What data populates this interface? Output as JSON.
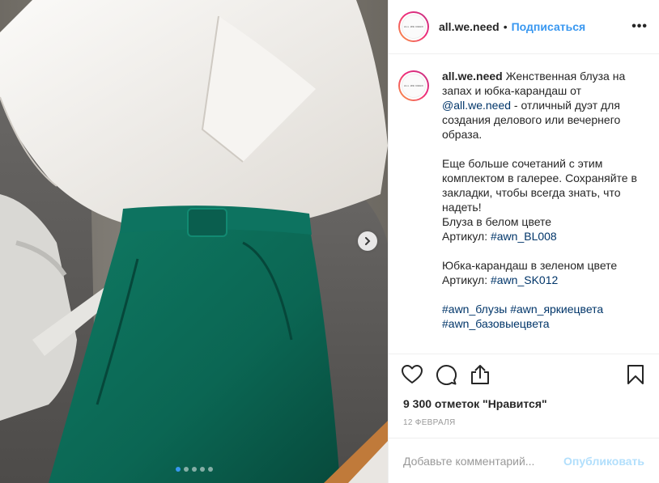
{
  "header": {
    "username": "all.we.need",
    "separator": "•",
    "follow_label": "Подписаться",
    "more_label": "•••"
  },
  "avatar": {
    "logo_text": "ALL WE NEED"
  },
  "caption": {
    "username": "all.we.need",
    "line1": " Женственная блуза на запах и юбка-карандаш от ",
    "mention": "@all.we.need",
    "line2": " - отличный дуэт для создания делового или вечернего образа.\n\nЕще больше сочетаний с этим комплектом в галерее. Сохраняйте в закладки, чтобы всегда знать, что надеть!\nБлуза в белом цвете\nАртикул: ",
    "tag1": "#awn_BL008",
    "line3": "\n\nЮбка-карандаш в зеленом цвете\nАртикул: ",
    "tag2": "#awn_SK012",
    "line4": "\n\n",
    "tag3": "#awn_блузы",
    "space1": " ",
    "tag4": "#awn_яркиецвета",
    "line5": "\n",
    "tag5": "#awn_базовыецвета",
    "line6": "\n\n.\n."
  },
  "likes": "9 300 отметок \"Нравится\"",
  "date": "12 февраля",
  "comment": {
    "placeholder": "Добавьте комментарий...",
    "post_label": "Опубликовать"
  },
  "carousel": {
    "slide_count": 5,
    "active_index": 0
  },
  "colors": {
    "link": "#003569",
    "follow": "#3897f0",
    "post_disabled": "#b2dffc",
    "skirt": "#0b6b57",
    "blouse": "#f1efec"
  },
  "icons": [
    "chevron-right-icon",
    "heart-icon",
    "comment-icon",
    "share-icon",
    "bookmark-icon",
    "more-icon"
  ]
}
